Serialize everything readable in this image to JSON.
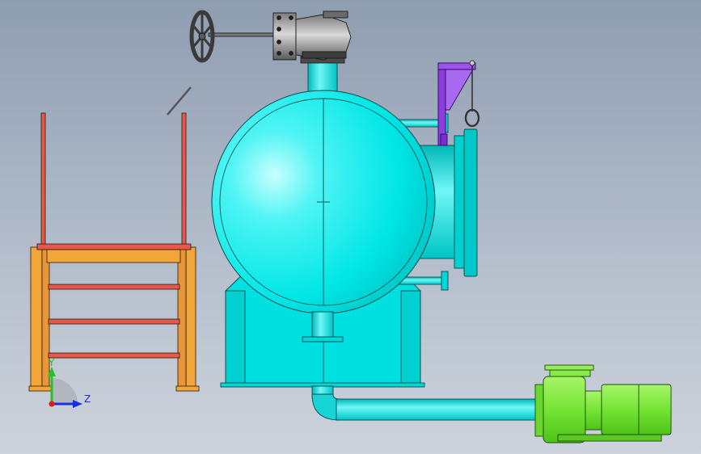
{
  "viewport": {
    "background_top": "#8f9db1",
    "background_bottom": "#cdd3dc"
  },
  "triad": {
    "y_label": "Y",
    "z_label": "Z",
    "y_color": "#22c22a",
    "z_color": "#1a2ee0",
    "x_color": "#e01a1a"
  },
  "parts": {
    "vessel_color": "#00e8e8",
    "stair_color": "#f2a63a",
    "handrail_color": "#e8584a",
    "bracket_color": "#8e3ee0",
    "pump_color": "#7ee83a",
    "valve_color": "#4a4a4a"
  }
}
